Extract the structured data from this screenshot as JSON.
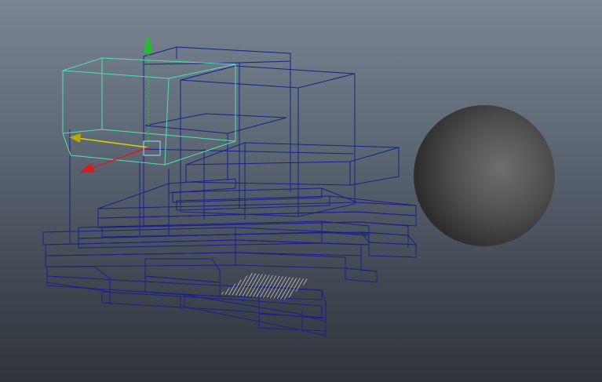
{
  "viewport": {
    "shading_mode": "wireframe",
    "background_top": "#7a8593",
    "background_bottom": "#2f343b"
  },
  "colors": {
    "wire": "#1a1f8a",
    "selected": "#4fe3b0",
    "axis_x": "#d41e1e",
    "axis_y": "#21c028",
    "axis_z": "#e0d000",
    "sphere_light": "#6e6e6e",
    "sphere_dark": "#2e2e2e",
    "hatch": "#d8d8d8"
  },
  "objects": [
    {
      "name": "selected-box",
      "kind": "box",
      "selected": true
    },
    {
      "name": "box-stack",
      "kind": "box-group",
      "selected": false
    },
    {
      "name": "pallet",
      "kind": "pallet",
      "selected": false
    },
    {
      "name": "sphere",
      "kind": "sphere",
      "shading": "smooth",
      "selected": false
    }
  ],
  "manipulator": {
    "type": "move",
    "axes": [
      "x",
      "y",
      "z"
    ]
  }
}
